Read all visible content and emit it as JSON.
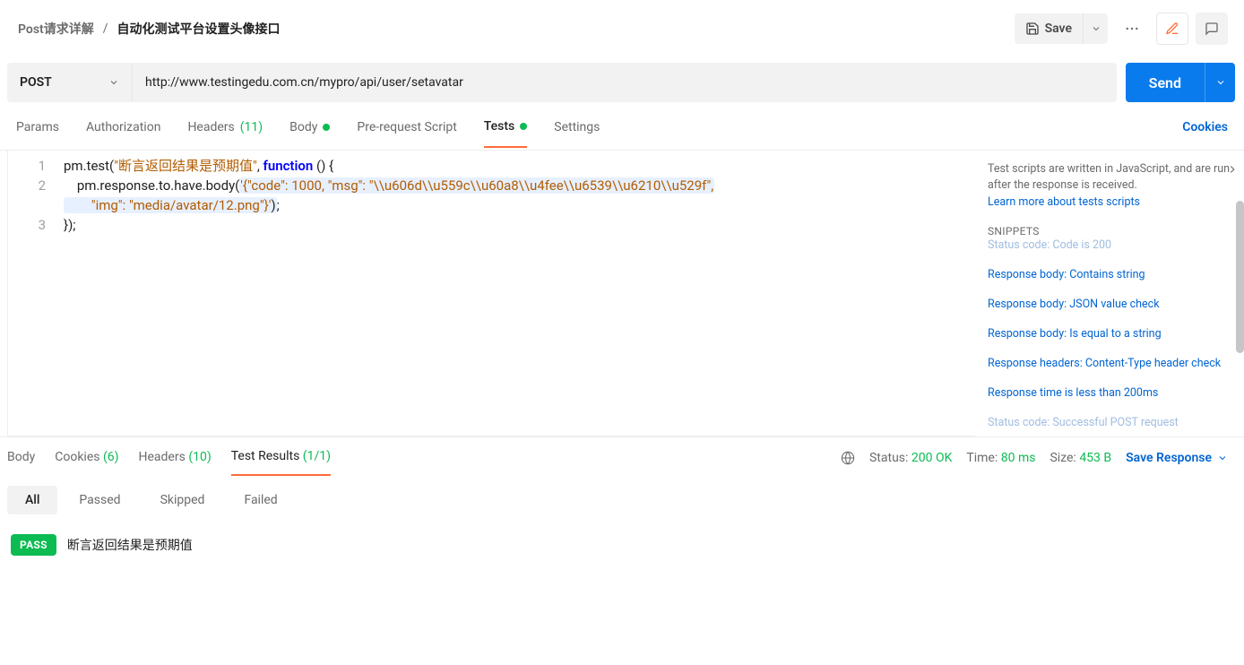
{
  "breadcrumb": {
    "parent": "Post请求详解",
    "current": "自动化测试平台设置头像接口"
  },
  "toolbar": {
    "save": "Save"
  },
  "request": {
    "method": "POST",
    "url": "http://www.testingedu.com.cn/mypro/api/user/setavatar",
    "send": "Send"
  },
  "tabs": {
    "params": "Params",
    "auth": "Authorization",
    "headers_label": "Headers",
    "headers_count": "(11)",
    "body": "Body",
    "prereq": "Pre-request Script",
    "tests": "Tests",
    "settings": "Settings",
    "cookies": "Cookies"
  },
  "code": {
    "l1a": "pm.test(",
    "l1b": "\"断言返回结果是预期值\"",
    "l1c": ", ",
    "l1d": "function",
    "l1e": " () {",
    "l2a": "    pm.response.to.have.body(",
    "l2b": "'{\"code\": 1000, \"msg\": \"\\\\u606d\\\\u559c\\\\u60a8\\\\u4fee\\\\u6539\\\\u6210\\\\u529f\",",
    "l2c": "        \"img\": \"media/avatar/12.png\"}'",
    "l2d": ")",
    "l2e": ";",
    "l3": "});",
    "ln1": "1",
    "ln2": "2",
    "ln3": "3"
  },
  "sidebar": {
    "desc": "Test scripts are written in JavaScript, and are run after the response is received.",
    "learn": "Learn more about tests scripts",
    "title": "SNIPPETS",
    "items": [
      "Status code: Code is 200",
      "Response body: Contains string",
      "Response body: JSON value check",
      "Response body: Is equal to a string",
      "Response headers: Content-Type header check",
      "Response time is less than 200ms",
      "Status code: Successful POST request"
    ]
  },
  "response": {
    "tabs": {
      "body": "Body",
      "cookies_label": "Cookies",
      "cookies_count": "(6)",
      "headers_label": "Headers",
      "headers_count": "(10)",
      "testresults_label": "Test Results",
      "testresults_count": "(1/1)"
    },
    "status_label": "Status:",
    "status_value": "200 OK",
    "time_label": "Time:",
    "time_value": "80 ms",
    "size_label": "Size:",
    "size_value": "453 B",
    "save": "Save Response"
  },
  "filters": {
    "all": "All",
    "passed": "Passed",
    "skipped": "Skipped",
    "failed": "Failed"
  },
  "result": {
    "badge": "PASS",
    "name": "断言返回结果是预期值"
  }
}
